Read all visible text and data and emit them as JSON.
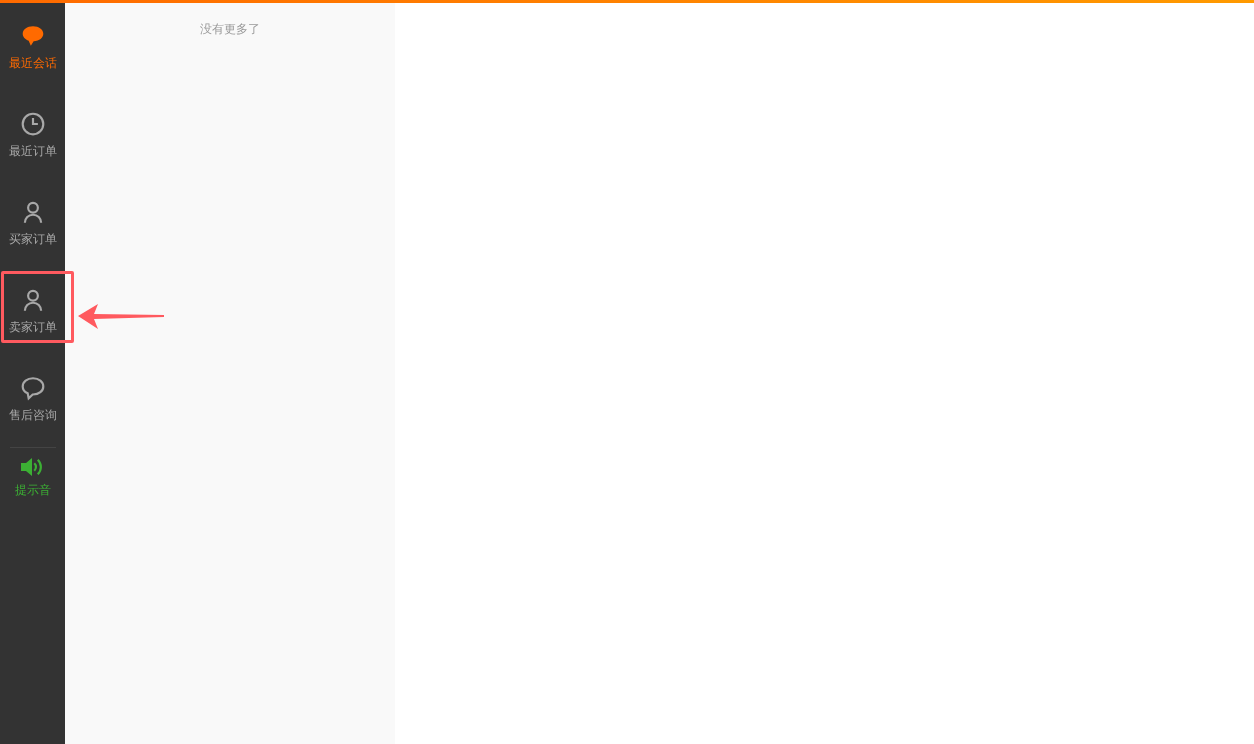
{
  "nav": [
    {
      "kind": "chat",
      "label": "最近会话",
      "selected": true,
      "highlighted": false
    },
    {
      "kind": "clock",
      "label": "最近订单",
      "selected": false,
      "highlighted": false
    },
    {
      "kind": "person",
      "label": "买家订单",
      "selected": false,
      "highlighted": false
    },
    {
      "kind": "person",
      "label": "卖家订单",
      "selected": false,
      "highlighted": true
    },
    {
      "kind": "bubble",
      "label": "售后咨询",
      "selected": false,
      "highlighted": false
    }
  ],
  "sound": {
    "label": "提示音",
    "on": true
  },
  "list": {
    "end_note": "没有更多了"
  }
}
